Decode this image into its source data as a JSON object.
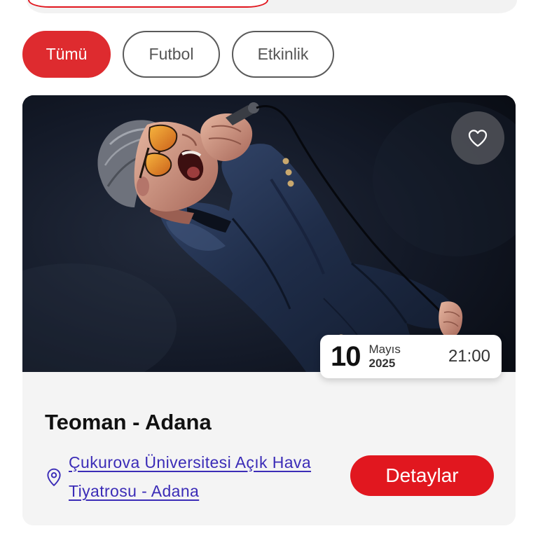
{
  "filters": [
    {
      "label": "Tümü",
      "active": true
    },
    {
      "label": "Futbol",
      "active": false
    },
    {
      "label": "Etkinlik",
      "active": false
    }
  ],
  "event": {
    "title": "Teoman - Adana",
    "date": {
      "day": "10",
      "month": "Mayıs",
      "year": "2025",
      "time": "21:00"
    },
    "venue": "Çukurova Üniversitesi Açık Hava Tiyatrosu - Adana",
    "details_label": "Detaylar",
    "is_favorite": false
  },
  "icons": {
    "favorite": "heart-icon",
    "location": "location-pin-icon"
  },
  "colors": {
    "accent": "#E1171F",
    "chip_active": "#DE2B2F",
    "chip_border": "#5A5A5A",
    "link": "#3B2CB7",
    "card_body": "#F4F4F4",
    "top_bar": "#F2F2F2",
    "text": "#111111"
  }
}
